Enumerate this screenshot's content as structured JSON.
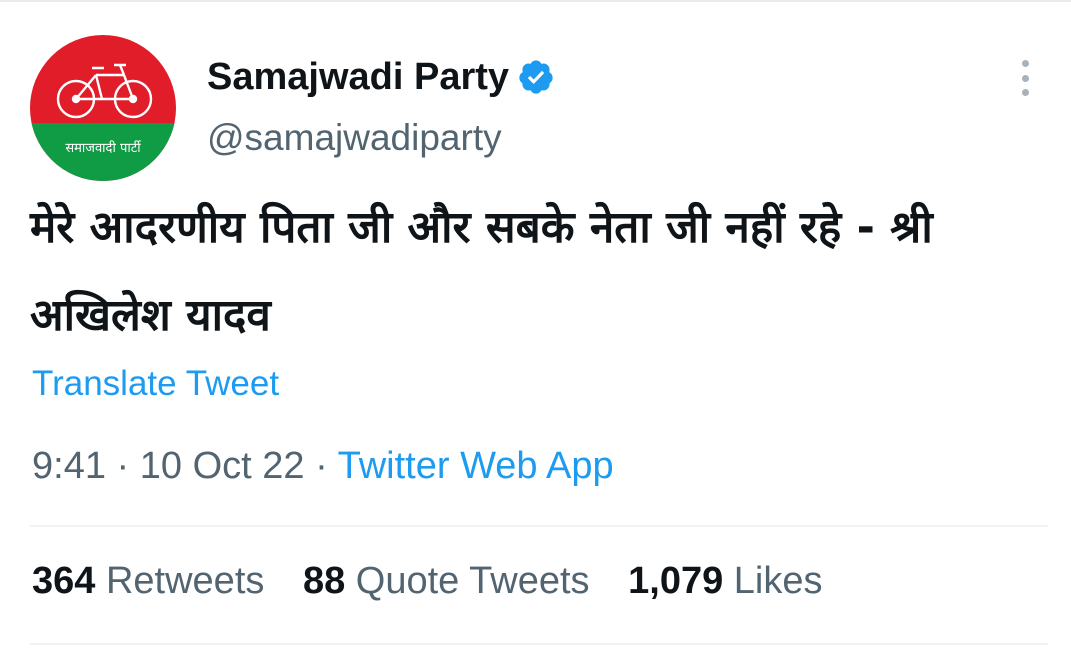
{
  "tweet": {
    "author": {
      "display_name": "Samajwadi Party",
      "handle": "@samajwadiparty",
      "verified": true,
      "avatar_text": "समाजवादी पार्टी"
    },
    "text": "मेरे आदरणीय पिता जी और सबके नेता जी नहीं रहे - श्री अखिलेश यादव",
    "translate_label": "Translate Tweet",
    "time": "9:41",
    "date": "10 Oct 22",
    "separator": "·",
    "source": "Twitter Web App",
    "stats": {
      "retweets_count": "364",
      "retweets_label": "Retweets",
      "quotes_count": "88",
      "quotes_label": "Quote Tweets",
      "likes_count": "1,079",
      "likes_label": "Likes"
    }
  },
  "colors": {
    "accent": "#1d9bf0",
    "secondary_text": "#536471",
    "avatar_red": "#e11d2a",
    "avatar_green": "#109c44"
  },
  "icons": [
    "verified-badge-icon",
    "more-options-icon",
    "bicycle-icon"
  ]
}
